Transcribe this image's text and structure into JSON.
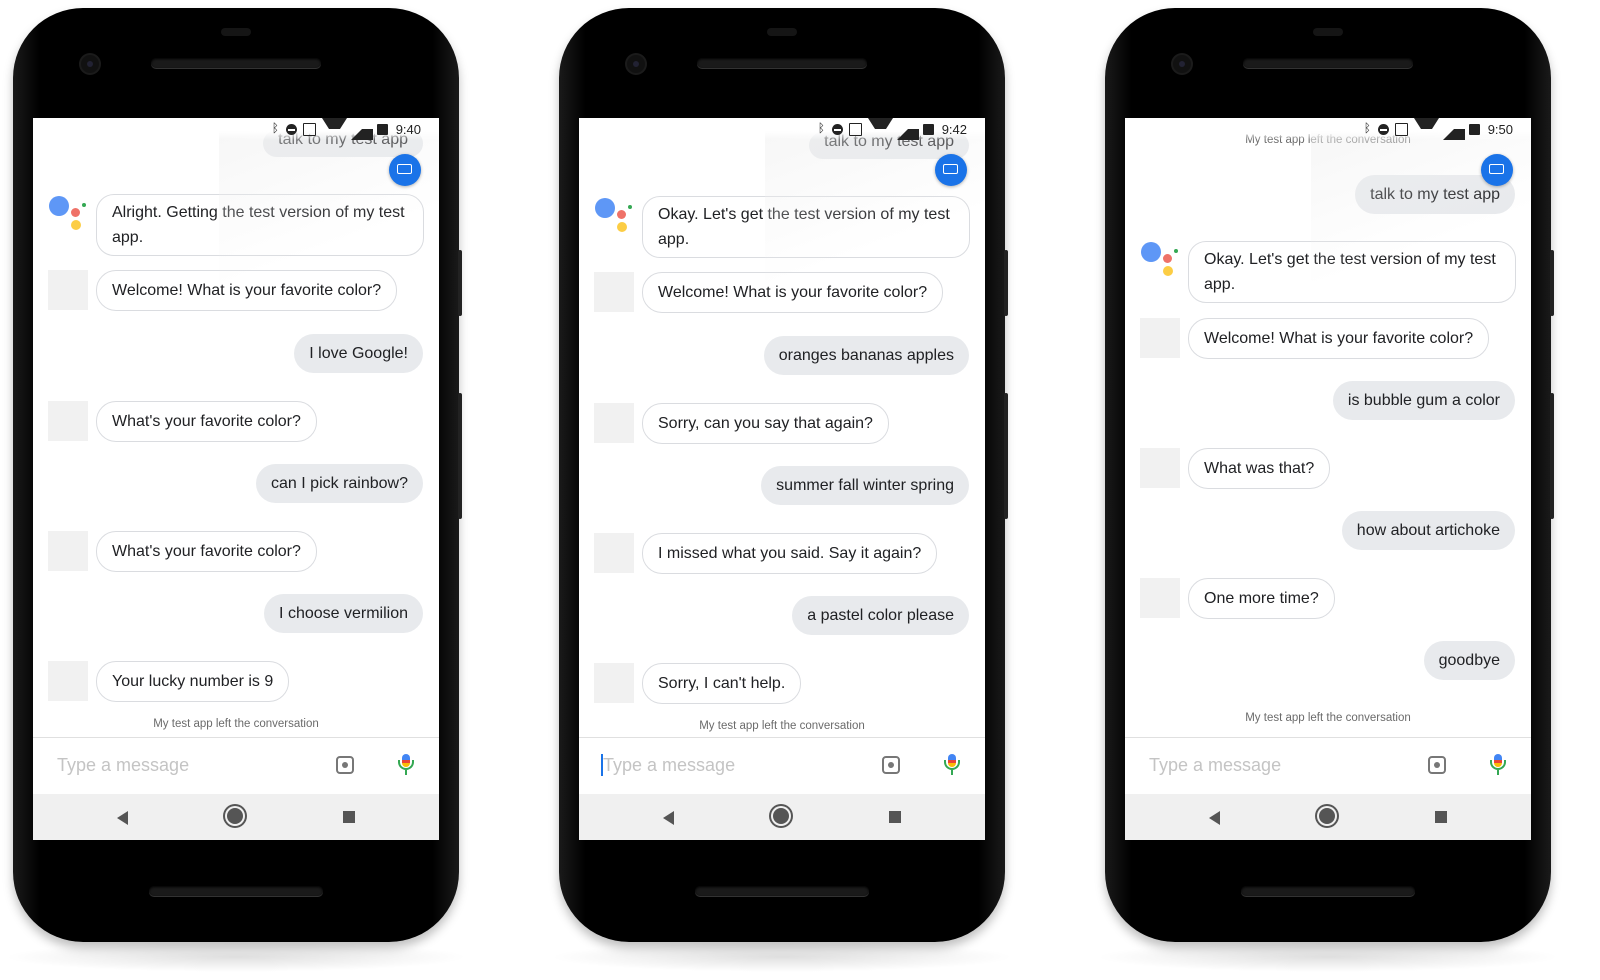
{
  "input_placeholder": "Type a message",
  "phones": [
    {
      "time": "9:40",
      "top_user_partial": "talk to my test app",
      "first_bot": "Alright. Getting the test version of my test app.",
      "messages": [
        {
          "from": "bot",
          "text": "Welcome! What is your favorite color?"
        },
        {
          "from": "user",
          "text": "I love Google!"
        },
        {
          "from": "bot",
          "text": "What's your favorite color?"
        },
        {
          "from": "user",
          "text": "can I pick rainbow?"
        },
        {
          "from": "bot",
          "text": "What's your favorite color?"
        },
        {
          "from": "user",
          "text": "I choose vermilion"
        },
        {
          "from": "bot",
          "text": "Your lucky number is 9"
        }
      ],
      "left_message": "My test app left the conversation"
    },
    {
      "time": "9:42",
      "top_user_partial": "talk to my test app",
      "first_bot": "Okay. Let's get the test version of my test app.",
      "messages": [
        {
          "from": "bot",
          "text": "Welcome! What is your favorite color?"
        },
        {
          "from": "user",
          "text": "oranges bananas apples"
        },
        {
          "from": "bot",
          "text": "Sorry, can you say that again?"
        },
        {
          "from": "user",
          "text": "summer fall winter spring"
        },
        {
          "from": "bot",
          "text": "I missed what you said. Say it again?"
        },
        {
          "from": "user",
          "text": "a pastel color please"
        },
        {
          "from": "bot",
          "text": "Sorry, I can't help."
        }
      ],
      "left_message": "My test app left the conversation"
    },
    {
      "time": "9:50",
      "top_system_partial": "My test app left the conversation",
      "top_user": "talk to my test app",
      "first_bot": "Okay. Let's get the test version of my test app.",
      "messages": [
        {
          "from": "bot",
          "text": "Welcome! What is your favorite color?"
        },
        {
          "from": "user",
          "text": "is bubble gum a color"
        },
        {
          "from": "bot",
          "text": "What was that?"
        },
        {
          "from": "user",
          "text": "how about artichoke"
        },
        {
          "from": "bot",
          "text": "One more time?"
        },
        {
          "from": "user",
          "text": "goodbye"
        }
      ],
      "left_message": "My test app left the conversation"
    }
  ]
}
